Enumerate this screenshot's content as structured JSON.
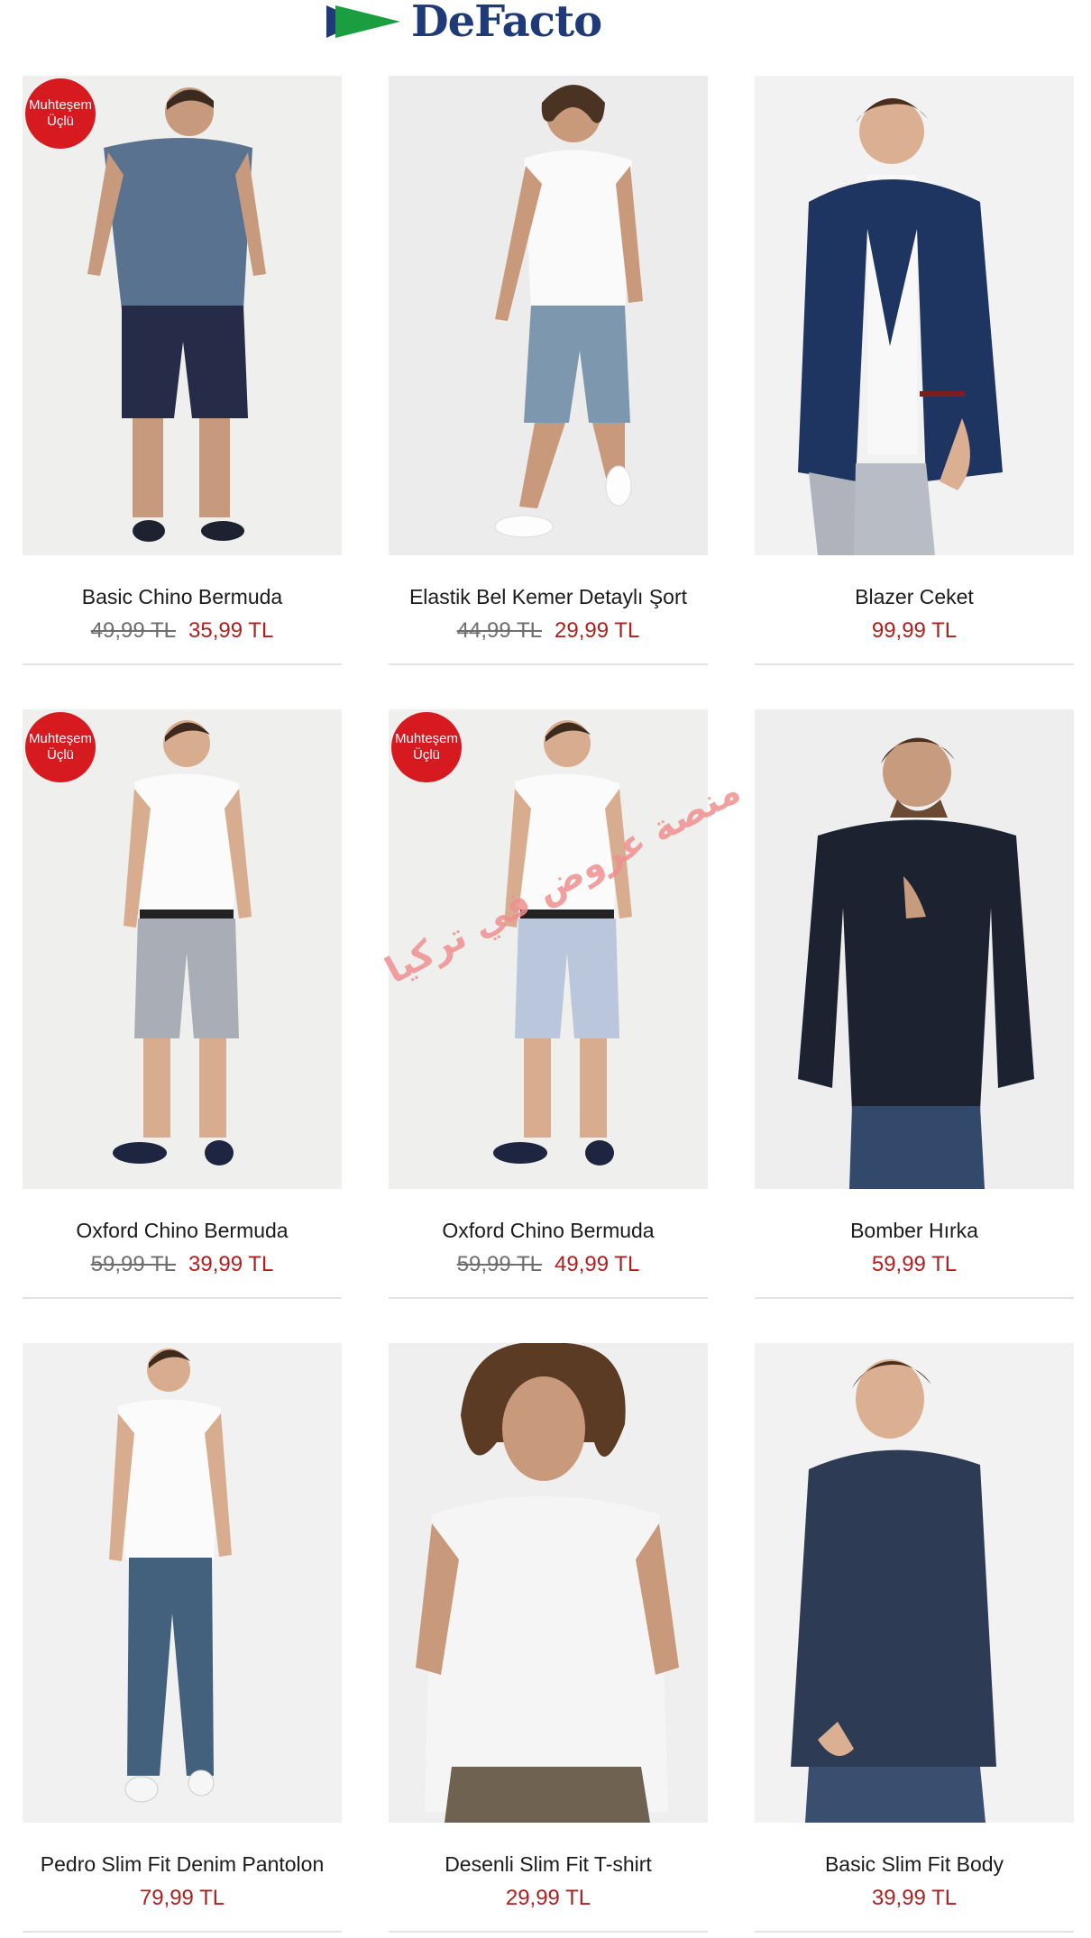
{
  "brand": {
    "logo_text": "DeFacto",
    "logo_colors": [
      "#1a9e3f",
      "#1e3a78"
    ]
  },
  "badge": {
    "line1": "Muhteşem",
    "line2": "Üçlü",
    "color": "#d71920"
  },
  "watermark": "منصة عروض في تركيا",
  "products": [
    {
      "name": "Basic Chino Bermuda",
      "old_price": "49,99 TL",
      "price": "35,99 TL",
      "badge": true
    },
    {
      "name": "Elastik Bel Kemer Detaylı Şort",
      "old_price": "44,99 TL",
      "price": "29,99 TL",
      "badge": false
    },
    {
      "name": "Blazer Ceket",
      "old_price": "",
      "price": "99,99 TL",
      "badge": false
    },
    {
      "name": "Oxford Chino Bermuda",
      "old_price": "59,99 TL",
      "price": "39,99 TL",
      "badge": true
    },
    {
      "name": "Oxford Chino Bermuda",
      "old_price": "59,99 TL",
      "price": "49,99 TL",
      "badge": true
    },
    {
      "name": "Bomber Hırka",
      "old_price": "",
      "price": "59,99 TL",
      "badge": false
    },
    {
      "name": "Pedro Slim Fit Denim Pantolon",
      "old_price": "",
      "price": "79,99 TL",
      "badge": false
    },
    {
      "name": "Desenli Slim Fit T-shirt",
      "old_price": "",
      "price": "29,99 TL",
      "badge": false
    },
    {
      "name": "Basic Slim Fit Body",
      "old_price": "",
      "price": "39,99 TL",
      "badge": false
    }
  ],
  "colors": {
    "price": "#b01f1f",
    "old_price": "#6e6e6e",
    "divider": "#e2e2e2"
  }
}
